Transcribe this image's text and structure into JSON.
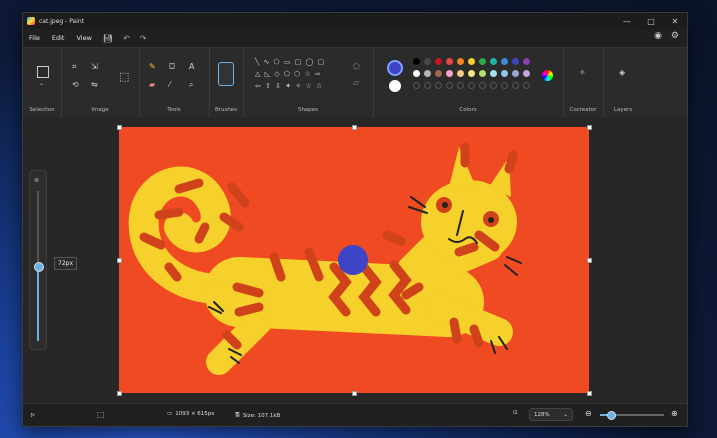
{
  "window": {
    "title": "cat.jpeg - Paint"
  },
  "menu": [
    "File",
    "Edit",
    "View"
  ],
  "ribbon": {
    "groups": [
      "Selection",
      "Image",
      "Tools",
      "Brushes",
      "Shapes",
      "Colors",
      "Cocreator",
      "Layers"
    ]
  },
  "colors": {
    "primary": "#3d44c5",
    "secondary": "#ffffff",
    "palette_row1": [
      "#000000",
      "#464646",
      "#c8142a",
      "#e84440",
      "#f6871f",
      "#f6d02b",
      "#2ea94a",
      "#20b3a4",
      "#3d8bdc",
      "#3d44c5",
      "#8a3fb0"
    ],
    "palette_row2": [
      "#ffffff",
      "#b4b4b4",
      "#9c6a4f",
      "#f6a3c5",
      "#f8c98a",
      "#f8e682",
      "#b4e06a",
      "#a2e4ea",
      "#8ec8f2",
      "#9aa6d6",
      "#c6a4dc"
    ]
  },
  "brush_size": {
    "tooltip": "72px",
    "level": 0.5
  },
  "status": {
    "canvas_size": "1093 × 615px",
    "file_size": "Size: 107.1kB",
    "zoom": "128%"
  }
}
